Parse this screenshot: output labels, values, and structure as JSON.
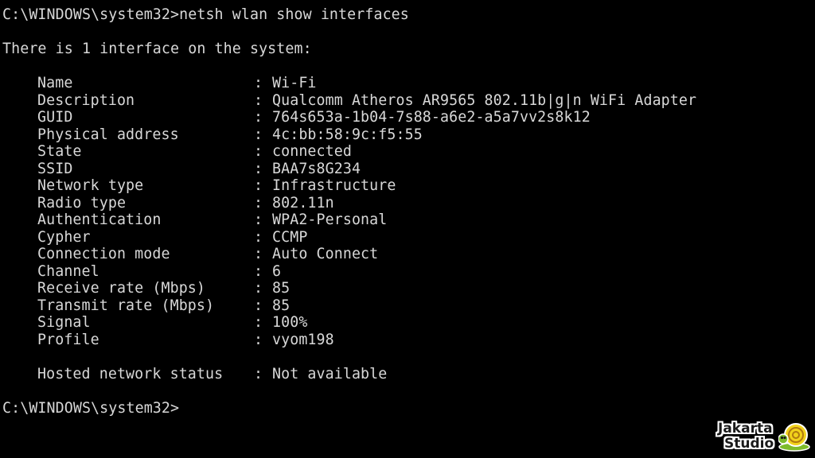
{
  "console": {
    "command_line": "C:\\WINDOWS\\system32>netsh wlan show interfaces",
    "intro": "There is 1 interface on the system:",
    "separator": ":",
    "fields": [
      {
        "key": "Name",
        "value": "Wi-Fi"
      },
      {
        "key": "Description",
        "value": "Qualcomm Atheros AR9565 802.11b|g|n WiFi Adapter"
      },
      {
        "key": "GUID",
        "value": "764s653a-1b04-7s88-a6e2-a5a7vv2s8k12"
      },
      {
        "key": "Physical address",
        "value": "4c:bb:58:9c:f5:55"
      },
      {
        "key": "State",
        "value": "connected"
      },
      {
        "key": "SSID",
        "value": "BAA7s8G234"
      },
      {
        "key": "Network type",
        "value": "Infrastructure"
      },
      {
        "key": "Radio type",
        "value": "802.11n"
      },
      {
        "key": "Authentication",
        "value": "WPA2-Personal"
      },
      {
        "key": "Cypher",
        "value": "CCMP"
      },
      {
        "key": "Connection mode",
        "value": "Auto Connect"
      },
      {
        "key": "Channel",
        "value": "6"
      },
      {
        "key": "Receive rate (Mbps)",
        "value": "85"
      },
      {
        "key": "Transmit rate (Mbps)",
        "value": "85"
      },
      {
        "key": "Signal",
        "value": "100%"
      },
      {
        "key": "Profile",
        "value": "vyom198"
      }
    ],
    "hosted": {
      "key": "Hosted network status",
      "value": "Not available"
    },
    "prompt": "C:\\WINDOWS\\system32>"
  },
  "watermark": {
    "line1": "Jakarta",
    "line2": "Studio",
    "icon": "snail-icon"
  },
  "colors": {
    "background": "#000000",
    "text": "#d8d8d8"
  }
}
